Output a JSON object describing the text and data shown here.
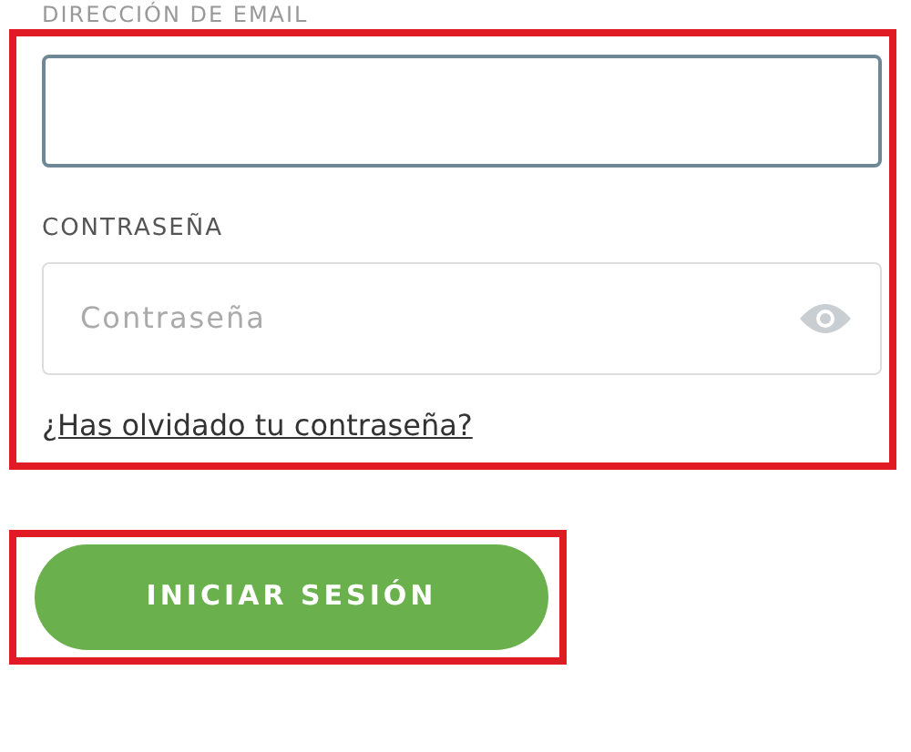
{
  "email": {
    "label": "DIRECCIÓN DE EMAIL",
    "focused": true
  },
  "password": {
    "label": "CONTRASEÑA",
    "placeholder": "Contraseña"
  },
  "forgot_link": "¿Has olvidado tu contraseña?",
  "login_button": "INICIAR SESIÓN"
}
